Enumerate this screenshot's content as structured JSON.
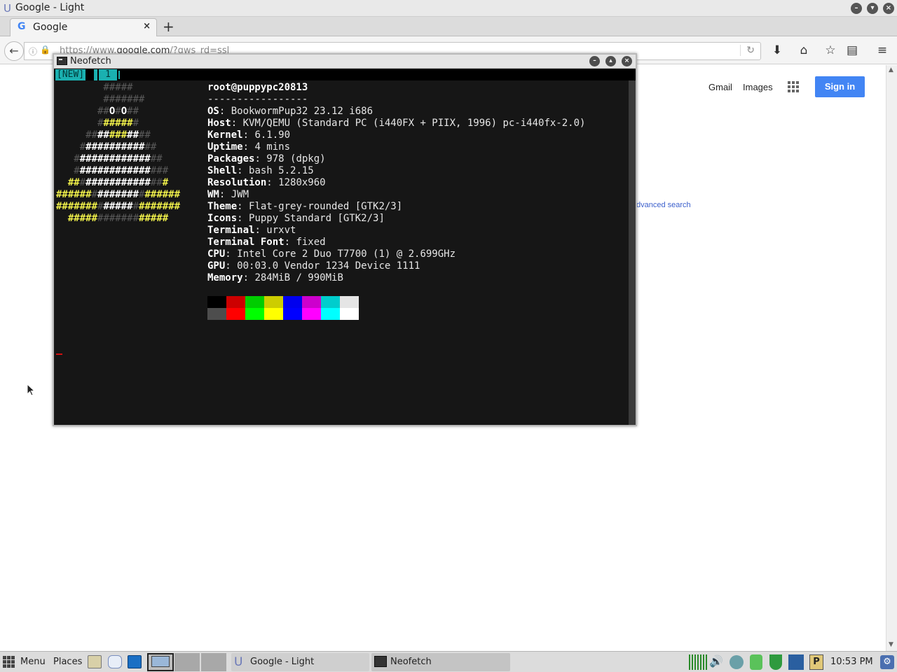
{
  "browser": {
    "window_title": "Google - Light",
    "tab_label": "Google",
    "tab_close": "×",
    "new_tab": "+",
    "url_dim_prefix": "https://www.",
    "url_host": "google.com",
    "url_dim_suffix": "/?gws_rd=ssl",
    "page": {
      "gmail": "Gmail",
      "images": "Images",
      "sign_in": "Sign in",
      "advanced_search": "dvanced search"
    },
    "accent": "#4285f4"
  },
  "terminal": {
    "title": "Neofetch",
    "tab_new": "[NEW]",
    "tab_one": "1",
    "user_host": "root@puppypc20813",
    "separator": "-----------------",
    "info": [
      {
        "key": "OS",
        "value": "BookwormPup32 23.12 i686"
      },
      {
        "key": "Host",
        "value": "KVM/QEMU (Standard PC (i440FX + PIIX, 1996) pc-i440fx-2.0)"
      },
      {
        "key": "Kernel",
        "value": "6.1.90"
      },
      {
        "key": "Uptime",
        "value": "4 mins"
      },
      {
        "key": "Packages",
        "value": "978 (dpkg)"
      },
      {
        "key": "Shell",
        "value": "bash 5.2.15"
      },
      {
        "key": "Resolution",
        "value": "1280x960"
      },
      {
        "key": "WM",
        "value": "JWM"
      },
      {
        "key": "Theme",
        "value": "Flat-grey-rounded [GTK2/3]"
      },
      {
        "key": "Icons",
        "value": "Puppy Standard [GTK2/3]"
      },
      {
        "key": "Terminal",
        "value": "urxvt"
      },
      {
        "key": "Terminal Font",
        "value": "fixed"
      },
      {
        "key": "CPU",
        "value": "Intel Core 2 Duo T7700 (1) @ 2.699GHz"
      },
      {
        "key": "GPU",
        "value": "00:03.0 Vendor 1234 Device 1111"
      },
      {
        "key": "Memory",
        "value": "284MiB / 990MiB"
      }
    ],
    "palette_top": [
      "#000000",
      "#cd0000",
      "#00cd00",
      "#cdcd00",
      "#0000ee",
      "#cd00cd",
      "#00cdcd",
      "#e5e5e5"
    ],
    "palette_bottom": [
      "#4d4d4d",
      "#ff0000",
      "#00ff00",
      "#ffff00",
      "#0000ff",
      "#ff00ff",
      "#00ffff",
      "#ffffff"
    ]
  },
  "taskbar": {
    "menu": "Menu",
    "places": "Places",
    "tasks": [
      {
        "label": "Google - Light"
      },
      {
        "label": "Neofetch"
      }
    ],
    "clock": "10:53 PM"
  }
}
